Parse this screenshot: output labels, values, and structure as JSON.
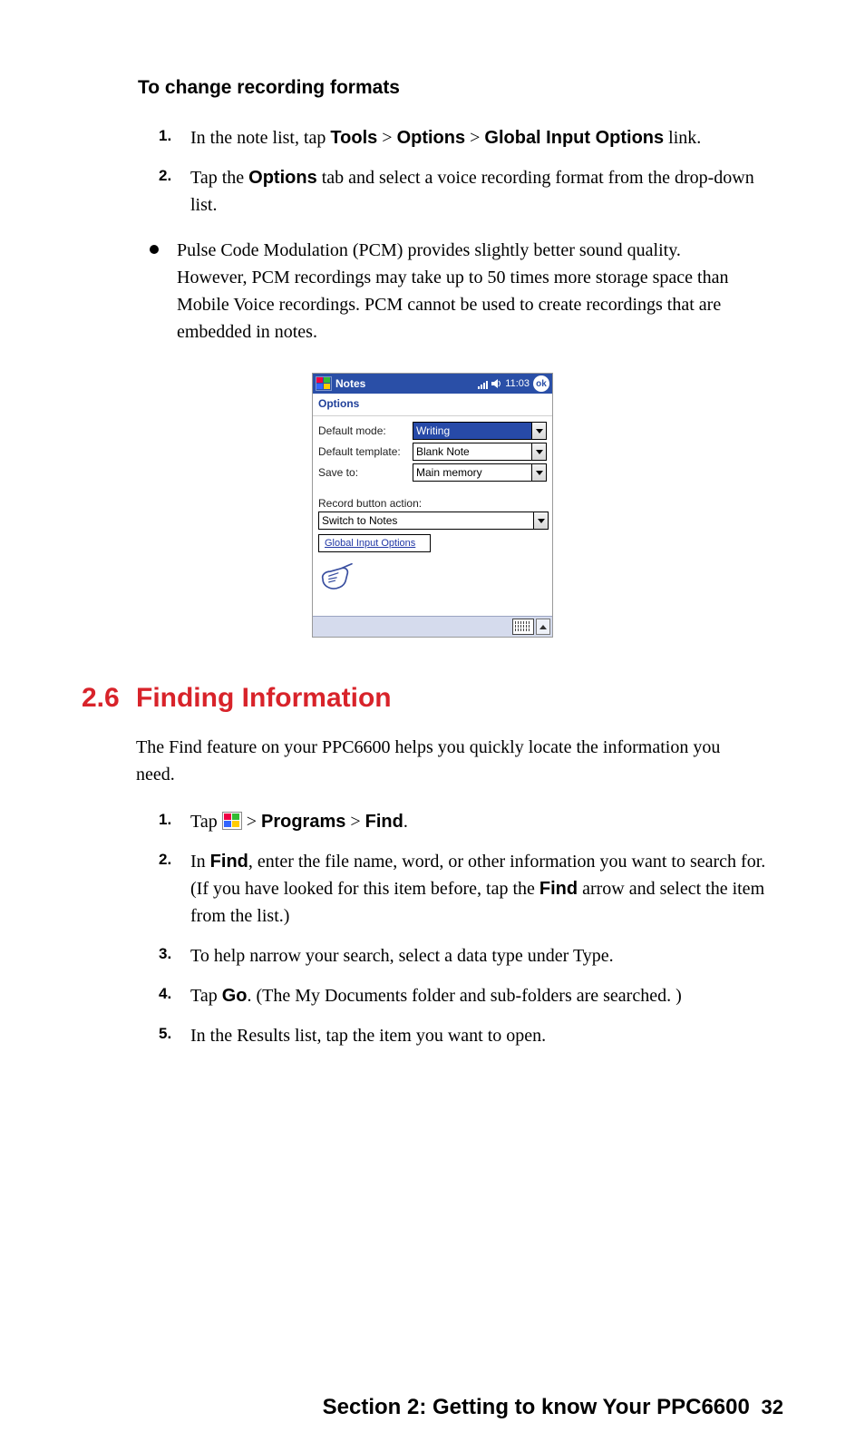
{
  "heading1": "To change recording formats",
  "list1": {
    "items": [
      {
        "num": "1.",
        "pre": "In the note list, tap ",
        "b1": "Tools",
        "gt1": " > ",
        "b2": "Options",
        "gt2": " > ",
        "b3": "Global Input Options",
        "post": " link."
      },
      {
        "num": "2.",
        "pre": "Tap the ",
        "b1": "Options",
        "post": " tab and select a voice recording format from the drop-down list."
      }
    ]
  },
  "bullet": "Pulse Code Modulation (PCM) provides slightly better sound quality. However, PCM recordings may take up to 50 times more storage space than Mobile Voice recordings. PCM cannot be used to create recordings that are embedded in notes.",
  "device": {
    "app_title": "Notes",
    "time": "11:03",
    "ok": "ok",
    "subhead": "Options",
    "rows": {
      "default_mode": {
        "label": "Default mode:",
        "value": "Writing"
      },
      "default_template": {
        "label": "Default template:",
        "value": "Blank Note"
      },
      "save_to": {
        "label": "Save to:",
        "value": "Main memory"
      }
    },
    "record_label": "Record button action:",
    "record_value": "Switch to Notes",
    "global_link": "Global Input Options"
  },
  "section": {
    "num": "2.6",
    "title": "Finding Information"
  },
  "para1": "The Find feature on your PPC6600 helps you quickly locate the information you need.",
  "list2": {
    "i1": {
      "num": "1.",
      "pre": "Tap ",
      "gt": " > ",
      "b1": "Programs",
      "gt2": " > ",
      "b2": "Find",
      "post": "."
    },
    "i2": {
      "num": "2.",
      "pre": "In ",
      "b1": "Find",
      "mid1": ", enter the file name, word, or other information you want to search for. (If you have looked for this item before, tap the ",
      "b2": "Find",
      "mid2": " arrow and select the item from the list.)"
    },
    "i3": {
      "num": "3.",
      "text": "To help narrow your search, select a data type under Type."
    },
    "i4": {
      "num": "4.",
      "pre": "Tap ",
      "b1": "Go",
      "post": ". (The My Documents folder and sub-folders are searched. )"
    },
    "i5": {
      "num": "5.",
      "text": "In the Results list, tap the item you want to open."
    }
  },
  "footer": {
    "text": "Section 2: Getting to know Your PPC6600",
    "page": "32"
  }
}
